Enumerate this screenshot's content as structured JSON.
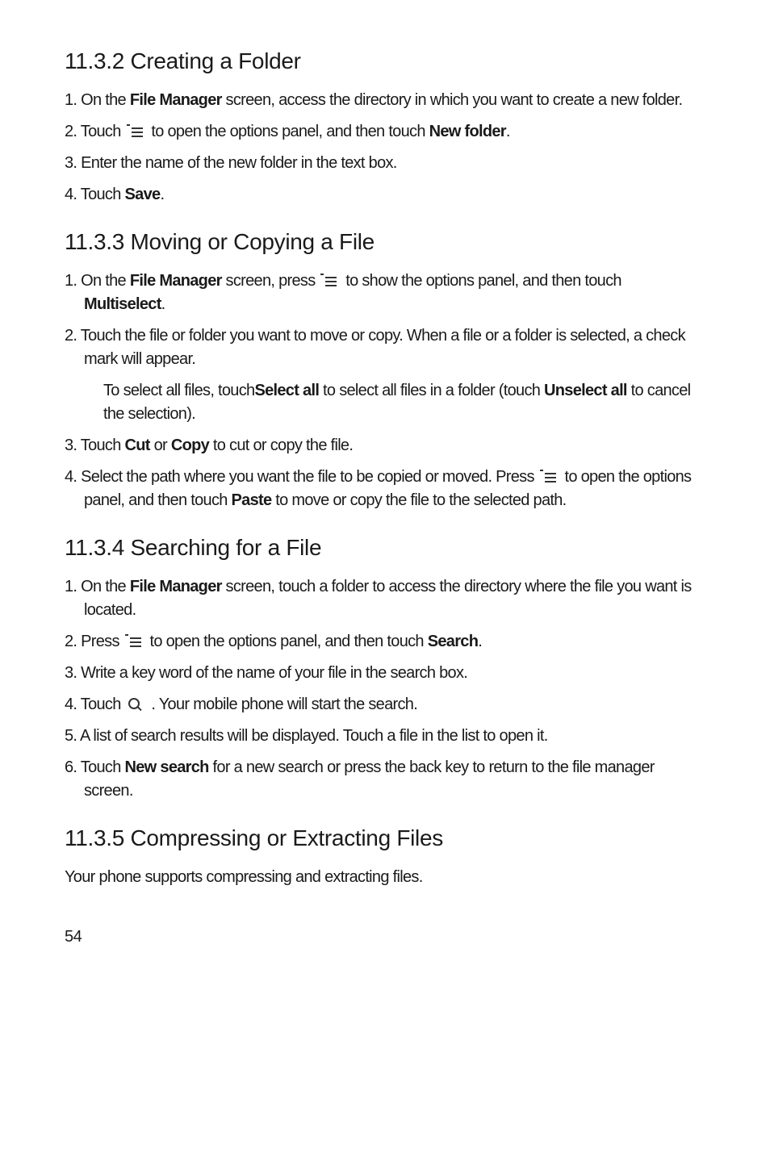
{
  "sections": {
    "s1": {
      "heading": "11.3.2  Creating a Folder",
      "steps": {
        "st1a": "1. On the ",
        "st1b": "File Manager",
        "st1c": " screen, access the directory in which you want to create a new folder.",
        "st2a": "2. Touch ",
        "st2b": " to open the options panel, and then touch ",
        "st2c": "New folder",
        "st2d": ".",
        "st3": "3. Enter the name of the new folder in the text box.",
        "st4a": "4. Touch ",
        "st4b": "Save",
        "st4c": "."
      }
    },
    "s2": {
      "heading": "11.3.3  Moving or Copying a File",
      "steps": {
        "st1a": "1. On the ",
        "st1b": "File Manager",
        "st1c": " screen, press ",
        "st1d": " to show the options panel, and then touch ",
        "st1e": "Multiselect",
        "st1f": ".",
        "st2": "2. Touch the file or folder you want to move or copy. When a file or a folder is selected, a check mark will appear.",
        "st2sub_a": "To select all files, touch",
        "st2sub_b": "Select all",
        "st2sub_c": " to select all files in a folder (touch ",
        "st2sub_d": "Unselect all",
        "st2sub_e": " to cancel the selection).",
        "st3a": "3. Touch ",
        "st3b": "Cut",
        "st3c": " or ",
        "st3d": "Copy",
        "st3e": " to cut or copy the file.",
        "st4a": "4. Select the path where you want the file to be copied or moved. Press ",
        "st4b": " to open the options panel, and then touch ",
        "st4c": "Paste",
        "st4d": " to move or copy the file to the selected path."
      }
    },
    "s3": {
      "heading": "11.3.4  Searching for a File",
      "steps": {
        "st1a": "1. On the ",
        "st1b": "File Manager",
        "st1c": " screen, touch a folder to access the directory where the file you want is located.",
        "st2a": "2. Press ",
        "st2b": " to open the options panel, and then touch ",
        "st2c": "Search",
        "st2d": ".",
        "st3": "3. Write a key word of the name of your file in the search box.",
        "st4a": "4. Touch ",
        "st4b": " . Your mobile phone will start the search.",
        "st5": "5. A list of search results will be displayed. Touch a file in the list to open it.",
        "st6a": "6. Touch ",
        "st6b": "New search",
        "st6c": " for a new search or press the back key to return to the file manager screen."
      }
    },
    "s4": {
      "heading": "11.3.5  Compressing or Extracting Files",
      "body": "Your phone supports compressing and extracting files."
    }
  },
  "page_number": "54"
}
